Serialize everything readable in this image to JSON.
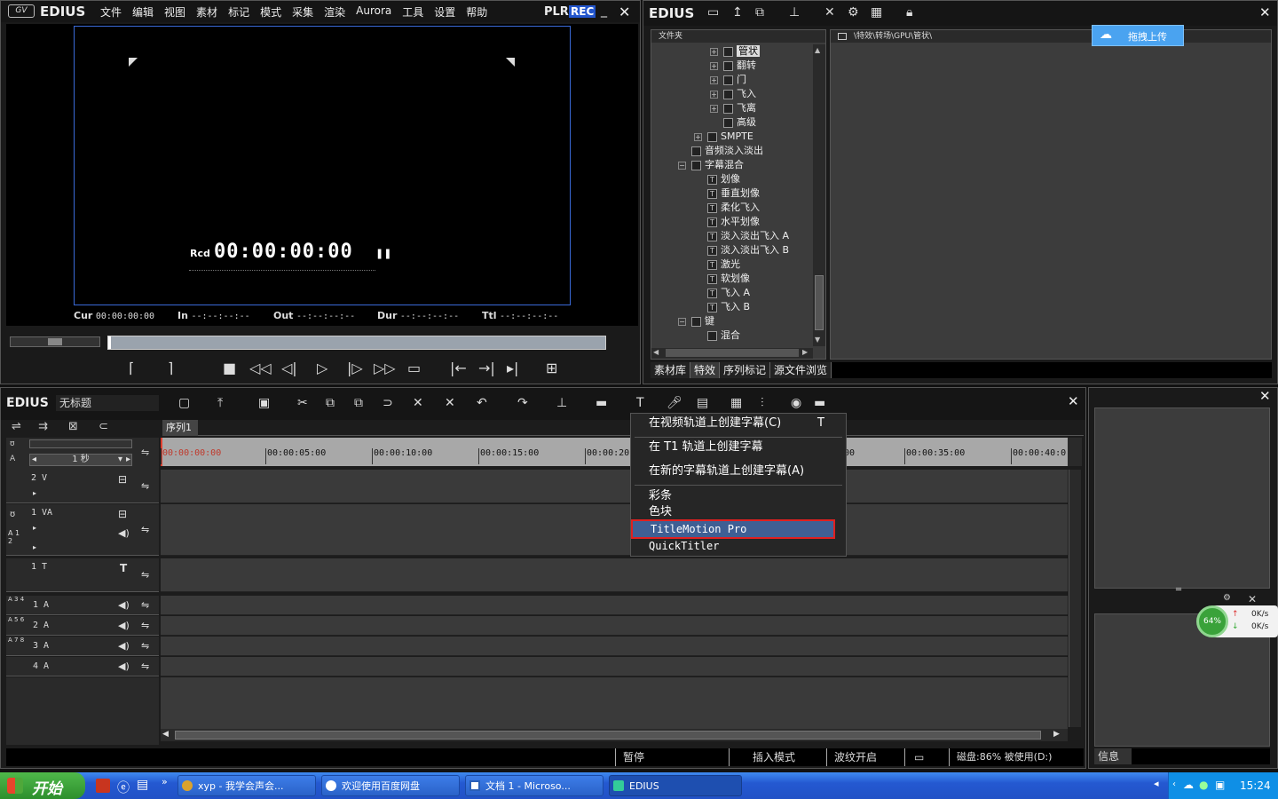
{
  "player": {
    "logo": "EDIUS",
    "menu": [
      "文件",
      "编辑",
      "视图",
      "素材",
      "标记",
      "模式",
      "采集",
      "渲染",
      "Aurora",
      "工具",
      "设置",
      "帮助"
    ],
    "plr": "PLR",
    "rec": "REC",
    "rcd_label": "Rcd",
    "timecode": "00:00:00:00",
    "cur_label": "Cur",
    "cur_value": "00:00:00:00",
    "in_label": "In",
    "in_value": "--:--:--:--",
    "out_label": "Out",
    "out_value": "--:--:--:--",
    "dur_label": "Dur",
    "dur_value": "--:--:--:--",
    "ttl_label": "Ttl",
    "ttl_value": "--:--:--:--"
  },
  "bin": {
    "logo": "EDIUS",
    "folder_header": "文件夹",
    "path": "\\特效\\转场\\GPU\\管状\\",
    "upload_btn": "拖拽上传",
    "tree": [
      {
        "label": "管状",
        "depth": 3,
        "expander": "+",
        "type": "folder",
        "selected": true
      },
      {
        "label": "翻转",
        "depth": 3,
        "expander": "+",
        "type": "folder"
      },
      {
        "label": "门",
        "depth": 3,
        "expander": "+",
        "type": "folder"
      },
      {
        "label": "飞入",
        "depth": 3,
        "expander": "+",
        "type": "folder"
      },
      {
        "label": "飞离",
        "depth": 3,
        "expander": "+",
        "type": "folder"
      },
      {
        "label": "高级",
        "depth": 3,
        "expander": "",
        "type": "folder"
      },
      {
        "label": "SMPTE",
        "depth": 2,
        "expander": "+",
        "type": "folder"
      },
      {
        "label": "音频淡入淡出",
        "depth": 1,
        "expander": "",
        "type": "folder"
      },
      {
        "label": "字幕混合",
        "depth": 1,
        "expander": "-",
        "type": "open"
      },
      {
        "label": "划像",
        "depth": 2,
        "expander": "",
        "type": "title"
      },
      {
        "label": "垂直划像",
        "depth": 2,
        "expander": "",
        "type": "title"
      },
      {
        "label": "柔化飞入",
        "depth": 2,
        "expander": "",
        "type": "title"
      },
      {
        "label": "水平划像",
        "depth": 2,
        "expander": "",
        "type": "title"
      },
      {
        "label": "淡入淡出飞入 A",
        "depth": 2,
        "expander": "",
        "type": "title"
      },
      {
        "label": "淡入淡出飞入 B",
        "depth": 2,
        "expander": "",
        "type": "title"
      },
      {
        "label": "激光",
        "depth": 2,
        "expander": "",
        "type": "title"
      },
      {
        "label": "软划像",
        "depth": 2,
        "expander": "",
        "type": "title"
      },
      {
        "label": "飞入 A",
        "depth": 2,
        "expander": "",
        "type": "title"
      },
      {
        "label": "飞入 B",
        "depth": 2,
        "expander": "",
        "type": "title"
      },
      {
        "label": "键",
        "depth": 1,
        "expander": "-",
        "type": "open"
      },
      {
        "label": "混合",
        "depth": 2,
        "expander": "",
        "type": "folder"
      }
    ],
    "tabs": [
      "素材库",
      "特效",
      "序列标记",
      "源文件浏览"
    ],
    "active_tab": "特效"
  },
  "timeline": {
    "logo": "EDIUS",
    "project_name": "无标题",
    "sequence_tab": "序列1",
    "scale": "1 秒",
    "ruler": [
      "00:00:00:00",
      "00:00:05:00",
      "00:00:10:00",
      "00:00:15:00",
      "00:00:20",
      "00",
      "00:00:35:00",
      "00:00:40:0"
    ],
    "tracks": [
      {
        "id": "2 V"
      },
      {
        "id": "1 VA"
      },
      {
        "id": "1 T"
      },
      {
        "id": "1 A",
        "side": "A 3 4"
      },
      {
        "id": "2 A",
        "side": "A 5 6"
      },
      {
        "id": "3 A",
        "side": "A 7 8"
      },
      {
        "id": "4 A",
        "side": ""
      }
    ],
    "side_labels": {
      "va": "A 1 2",
      "a1": "A 3 4",
      "a2": "A 5 6",
      "a3": "A 7 8"
    },
    "status": {
      "pause": "暂停",
      "insert": "插入模式",
      "ripple": "波纹开启",
      "disk": "磁盘:86% 被使用(D:)"
    }
  },
  "context_menu": {
    "items": [
      {
        "label": "在视频轨道上创建字幕(C)",
        "shortcut": "T"
      },
      {
        "label": "在 T1 轨道上创建字幕",
        "shortcut": ""
      },
      {
        "label": "在新的字幕轨道上创建字幕(A)",
        "shortcut": ""
      },
      {
        "label": "彩条",
        "shortcut": ""
      },
      {
        "label": "色块",
        "shortcut": ""
      },
      {
        "label": "TitleMotion Pro",
        "shortcut": "",
        "highlighted": true
      },
      {
        "label": "QuickTitler",
        "shortcut": ""
      }
    ]
  },
  "info_panel": {
    "tab": "信息"
  },
  "net_widget": {
    "percent": "64%",
    "up": "0K/s",
    "down": "0K/s"
  },
  "taskbar": {
    "start": "开始",
    "tasks": [
      "xyp - 我学会声会...",
      "欢迎使用百度网盘",
      "文档 1 - Microso...",
      "EDIUS"
    ],
    "clock": "15:24"
  }
}
